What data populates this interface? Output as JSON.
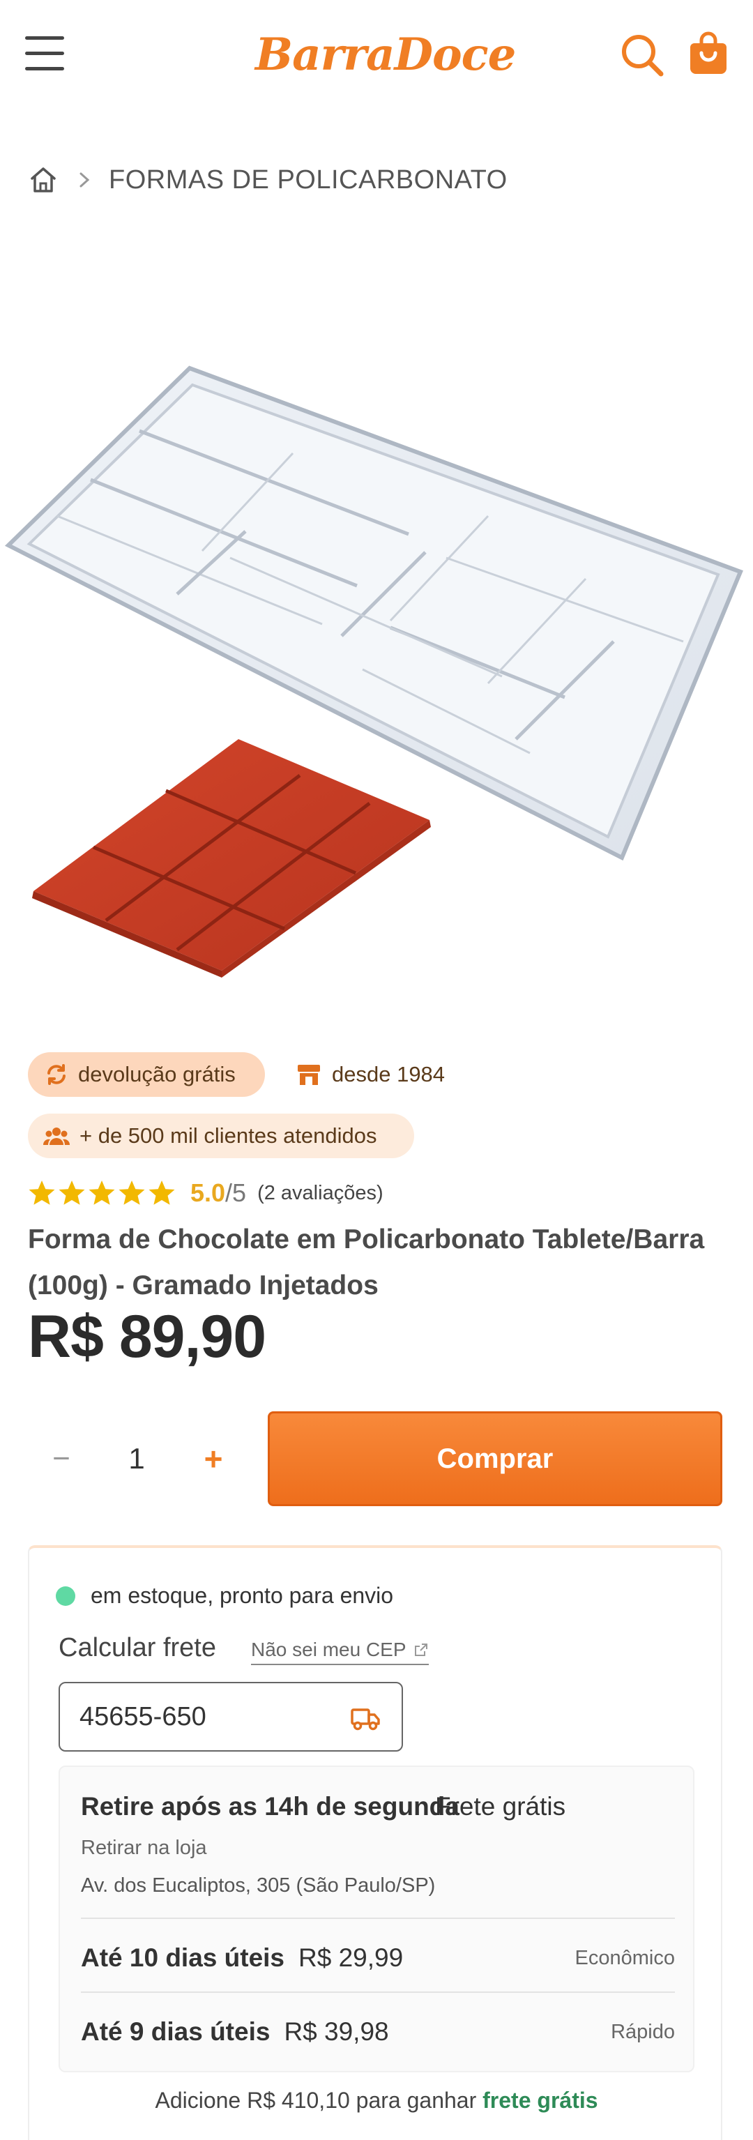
{
  "header": {
    "logo_text": "BarraDoce",
    "brand_color": "#F07E24",
    "menu_icon": "hamburger-icon",
    "search_icon": "search-icon",
    "cart_icon": "cart-icon"
  },
  "breadcrumb": {
    "home_icon": "home-icon",
    "current": "FORMAS DE POLICARBONATO"
  },
  "badges": {
    "returns": "devolução grátis",
    "since": "desde 1984",
    "clients": "+ de 500 mil clientes atendidos"
  },
  "rating": {
    "stars": 5,
    "score": "5.0",
    "max": "/5",
    "count": "(2 avaliações)"
  },
  "product": {
    "title": "Forma de Chocolate em Policarbonato Tablete/Barra (100g) - Gramado Injetados",
    "price": "R$ 89,90"
  },
  "purchase": {
    "minus": "−",
    "quantity": "1",
    "plus": "+",
    "buy_label": "Comprar"
  },
  "shipping": {
    "stock_status": "em estoque, pronto para envio",
    "calc_label": "Calcular frete",
    "cep_link": "Não sei meu CEP",
    "cep_value": "45655-650",
    "pickup": {
      "title": "Retire após as 14h de segunda",
      "price": "Frete grátis",
      "subtitle": "Retirar na loja",
      "address": "Av. dos Eucaliptos, 305 (São Paulo/SP)"
    },
    "options": [
      {
        "days": "Até 10 dias úteis",
        "price": "R$ 29,99",
        "type": "Econômico"
      },
      {
        "days": "Até 9 dias úteis",
        "price": "R$ 39,98",
        "type": "Rápido"
      }
    ],
    "free_shipping_prefix": "Adicione R$ 410,10 para ganhar",
    "free_shipping_highlight": "frete grátis"
  }
}
